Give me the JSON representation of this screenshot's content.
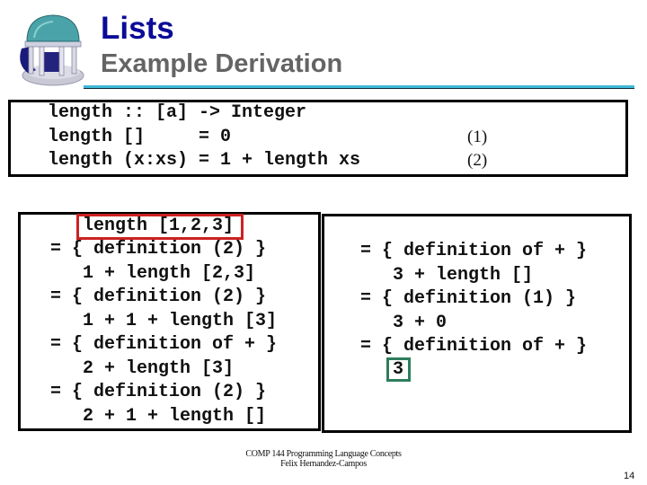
{
  "slide": {
    "title": "Lists",
    "subtitle": "Example Derivation",
    "logo_icon": "old-well-logo"
  },
  "definitions": {
    "lines": [
      "length :: [a] -> Integer",
      "length []     = 0",
      "length (x:xs) = 1 + length xs"
    ],
    "refs": [
      "(1)",
      "(2)"
    ]
  },
  "derivation_left": {
    "start": "length [1,2,3]",
    "lines": [
      "= { definition (2) }",
      "   1 + length [2,3]",
      "= { definition (2) }",
      "   1 + 1 + length [3]",
      "= { definition of + }",
      "   2 + length [3]",
      "= { definition (2) }",
      "   2 + 1 + length []"
    ]
  },
  "derivation_right": {
    "lines": [
      "= { definition of + }",
      "   3 + length []",
      "= { definition (1) }",
      "   3 + 0",
      "= { definition of + }"
    ],
    "result": "3"
  },
  "highlight_colors": {
    "start": "#cc2222",
    "result": "#2e7d5c",
    "title": "#0b0b98",
    "rule": "#3fb8d8"
  },
  "footer": {
    "course": "COMP 144 Programming Language Concepts",
    "author": "Felix Hernandez-Campos",
    "page_number": "14"
  }
}
